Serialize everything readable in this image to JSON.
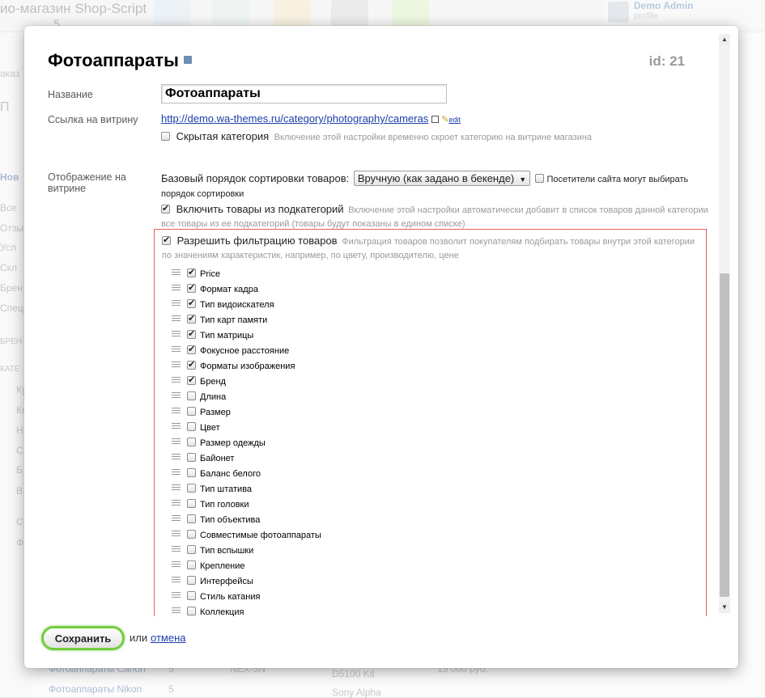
{
  "background": {
    "title_line1": "ио-магазин Shop-Script",
    "title_line2": "5",
    "user_name": "Demo Admin",
    "user_sub": "profile",
    "side_items": [
      "аказ",
      "П",
      "Нов",
      "Все",
      "Отзы",
      "Усл",
      "Скл",
      "Брен",
      "Спец",
      "БРЕН",
      "КАТЕ",
      "Ку",
      "Ко",
      "Н",
      "С",
      "Б",
      "В",
      "С",
      "Ф"
    ],
    "bottom_items": [
      "Фотоаппараты Canon",
      "Фотоаппараты Nikon",
      "D5100 Kit",
      "Sony Alpha",
      "5",
      "5",
      "NEX-5N",
      "15 000 руб."
    ]
  },
  "dialog": {
    "title": "Фотоаппараты",
    "id_label": "id: 21",
    "name_label": "Название",
    "name_value": "Фотоаппараты",
    "storefront_label": "Ссылка на витрину",
    "storefront_url": "http://demo.wa-themes.ru/category/photography/cameras",
    "edit_link": "edit",
    "hidden_category_label": "Скрытая категория",
    "hidden_category_hint": "Включение этой настройки временно скроет категорию на витрине магазина",
    "display_label": "Отображение на витрине",
    "sort_label": "Базовый порядок сортировки товаров:",
    "sort_value": "Вручную (как задано в бекенде)",
    "visitors_choose_label": "Посетители сайта могут выбирать порядок сортировки",
    "include_sub_label": "Включить товары из подкатегорий",
    "include_sub_hint": "Включение этой настройки автоматически добавит в список товаров данной категории все товары из ее подкатегорий (товары будут показаны в едином списке)",
    "filter_label": "Разрешить фильтрацию товаров",
    "filter_hint": "Фильтрация товаров позволит покупателям подбирать товары внутри этой категории по значениям характеристик, например, по цвету, производителю, цене",
    "filters": [
      {
        "label": "Price",
        "checked": true
      },
      {
        "label": "Формат кадра",
        "checked": true
      },
      {
        "label": "Тип видоискателя",
        "checked": true
      },
      {
        "label": "Тип карт памяти",
        "checked": true
      },
      {
        "label": "Тип матрицы",
        "checked": true
      },
      {
        "label": "Фокусное расстояние",
        "checked": true
      },
      {
        "label": "Форматы изображения",
        "checked": true
      },
      {
        "label": "Бренд",
        "checked": true
      },
      {
        "label": "Длина",
        "checked": false
      },
      {
        "label": "Размер",
        "checked": false
      },
      {
        "label": "Цвет",
        "checked": false
      },
      {
        "label": "Размер одежды",
        "checked": false
      },
      {
        "label": "Байонет",
        "checked": false
      },
      {
        "label": "Баланс белого",
        "checked": false
      },
      {
        "label": "Тип штатива",
        "checked": false
      },
      {
        "label": "Тип головки",
        "checked": false
      },
      {
        "label": "Тип объектива",
        "checked": false
      },
      {
        "label": "Совместимые фотоаппараты",
        "checked": false
      },
      {
        "label": "Тип вспышки",
        "checked": false
      },
      {
        "label": "Крепление",
        "checked": false
      },
      {
        "label": "Интерфейсы",
        "checked": false
      },
      {
        "label": "Стиль катания",
        "checked": false
      },
      {
        "label": "Коллекция",
        "checked": false
      }
    ],
    "save_label": "Сохранить",
    "or_label": "или",
    "cancel_label": "отмена"
  },
  "colors": {
    "save_border": "#72cd3c",
    "filter_box_border": "#e46060",
    "link": "#1b3ea8"
  }
}
